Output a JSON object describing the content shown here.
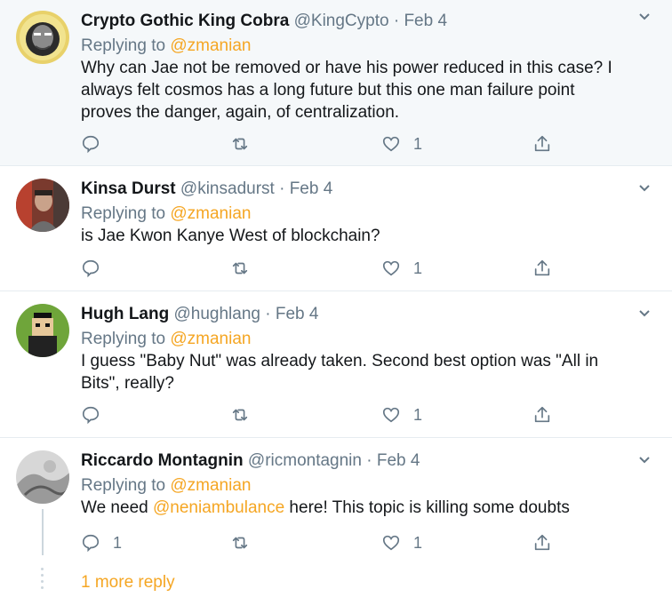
{
  "tweets": [
    {
      "name": "Crypto Gothic King Cobra",
      "handle": "@KingCypto",
      "date": "Feb 4",
      "replying_label": "Replying to",
      "replying_to": "@zmanian",
      "text_lines": [
        "Why can Jae not be removed or have his power reduced in this case? I",
        "always felt cosmos has a long future but this one man failure point",
        "proves the danger, again, of centralization."
      ],
      "reply_count": "",
      "like_count": "1"
    },
    {
      "name": "Kinsa Durst",
      "handle": "@kinsadurst",
      "date": "Feb 4",
      "replying_label": "Replying to",
      "replying_to": "@zmanian",
      "text_lines": [
        "is Jae Kwon Kanye West of blockchain?"
      ],
      "reply_count": "",
      "like_count": "1"
    },
    {
      "name": "Hugh Lang",
      "handle": "@hughlang",
      "date": "Feb 4",
      "replying_label": "Replying to",
      "replying_to": "@zmanian",
      "text_lines": [
        "I guess \"Baby Nut\" was already taken. Second best option was \"All in",
        "Bits\", really?"
      ],
      "reply_count": "",
      "like_count": "1"
    },
    {
      "name": "Riccardo Montagnin",
      "handle": "@ricmontagnin",
      "date": "Feb 4",
      "replying_label": "Replying to",
      "replying_to": "@zmanian",
      "text_before": "We need ",
      "text_mention": "@neniambulance",
      "text_after": " here! This topic is killing some doubts",
      "reply_count": "1",
      "like_count": "1"
    }
  ],
  "separator": "·",
  "more_replies": "1 more reply",
  "colors": {
    "accent": "#f5a623",
    "muted": "#657786",
    "highlight_bg": "#f5f8fa"
  },
  "icons": [
    "reply-icon",
    "retweet-icon",
    "heart-icon",
    "share-icon",
    "chevron-down-icon"
  ]
}
